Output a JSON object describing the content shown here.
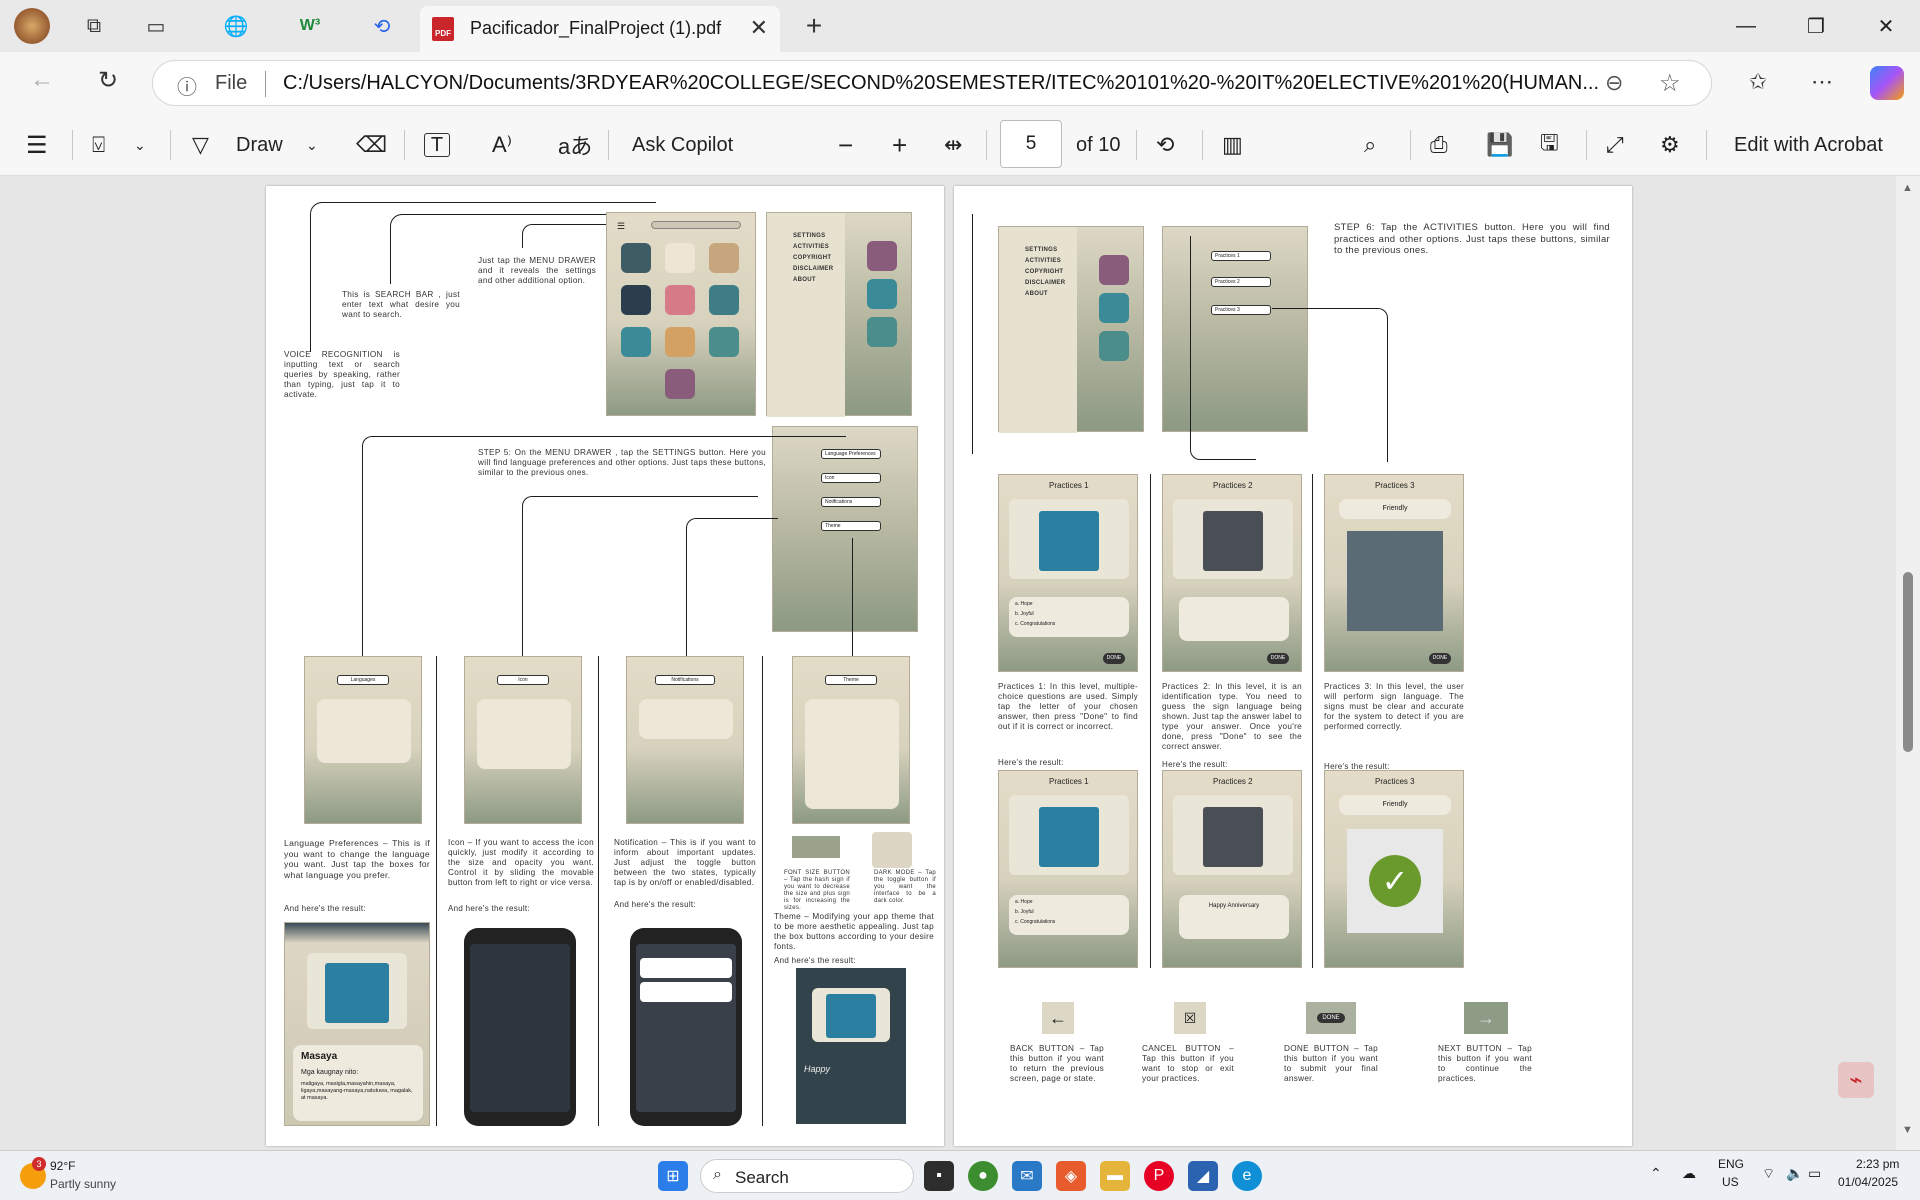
{
  "tabbar": {
    "active_tab_title": "Pacificador_FinalProject (1).pdf",
    "new_tab_symbol": "+",
    "close_tab_symbol": "✕",
    "pdf_badge": "PDF"
  },
  "address": {
    "info_label": "File",
    "url": "C:/Users/HALCYON/Documents/3RDYEAR%20COLLEGE/SECOND%20SEMESTER/ITEC%20101%20-%20IT%20ELECTIVE%201%20(HUMAN..."
  },
  "pdf_toolbar": {
    "draw_label": "Draw",
    "ask_copilot": "Ask Copilot",
    "page_current": "5",
    "page_total": "of 10",
    "edit_acrobat": "Edit with Acrobat"
  },
  "page_left": {
    "voice_note": "VOICE RECOGNITION is inputting text or search queries by speaking, rather than typing, just tap it to activate.",
    "search_note": "This is SEARCH BAR , just enter text what desire you want to search.",
    "menu_note": "Just tap the MENU DRAWER and it reveals the settings and other additional option.",
    "menu_items": [
      "SETTINGS",
      "ACTIVITIES",
      "COPYRIGHT",
      "DISCLAIMER",
      "ABOUT"
    ],
    "step5_note": "STEP 5: On the MENU DRAWER , tap the SETTINGS button. Here you will find language preferences and other options. Just taps these buttons, similar to the previous ones.",
    "settings_items": [
      "Language Preferences",
      "Icon",
      "Notifications",
      "Theme"
    ],
    "screens": [
      "Languages",
      "Icon",
      "Notifications",
      "Theme"
    ],
    "lang_note": "Language Preferences – This is if you want to change the language you want. Just tap the boxes for what language you prefer.",
    "icon_note": "Icon – If you want to access the icon quickly, just modify it according to the size and opacity you want. Control it by sliding the movable button from left to right or vice versa.",
    "notif_note": "Notification – This is if you want to inform about important updates. Just adjust the toggle button between the two states, typically tap is by on/off or enabled/disabled.",
    "font_note": "FONT SIZE BUTTON – Tap the hash sign if you want to decrease the size and plus sign is for increasing the sizes.",
    "dark_note": "DARK MODE – Tap the toggle button if you want the interface to be a dark color.",
    "theme_note": "Theme – Modifying your app theme that to be more aesthetic appealing. Just tap the box buttons according to your desire fonts.",
    "result_label": "And here's the result:",
    "result_label2": "And here's the result:",
    "masaya_word": "Masaya",
    "masaya_sub": "Mga kaugnay nito:",
    "masaya_related": "maligaya, masigla,masayahin,masaya, ligaya,masayang-masaya,natutuwa, magalak, at masaya.",
    "happy_word": "Happy"
  },
  "page_right": {
    "step6_note": "STEP 6: Tap the ACTIVITIES button. Here you will find practices and other options. Just taps these buttons, similar to the previous ones.",
    "menu_items": [
      "SETTINGS",
      "ACTIVITIES",
      "COPYRIGHT",
      "DISCLAIMER",
      "ABOUT"
    ],
    "practice_chips": [
      "Practices 1",
      "Practices 2",
      "Practices 3"
    ],
    "p1_title": "Practices 1",
    "p2_title": "Practices 2",
    "p3_title": "Practices 3",
    "p1_options": [
      "a. Hope",
      "b. Joyful",
      "c. Congratulations"
    ],
    "p3_word": "Friendly",
    "done_label": "DONE",
    "p1_note": "Practices 1: In this level, multiple-choice questions are used. Simply tap the letter of your chosen answer, then press \"Done\" to find out if it is correct or incorrect.",
    "p2_note": "Practices 2: In this level, it is an identification type. You need to guess the sign language being shown. Just tap the answer label to type your answer. Once you're done, press \"Done\" to see the correct answer.",
    "p3_note": "Practices 3: In this level, the user will perform sign language. The signs must be clear and accurate for the system to detect if you are performed correctly.",
    "result_label": "Here's the result:",
    "p2_answer": "Happy Anniversary",
    "back_note": "BACK BUTTON – Tap this button if you want to return the previous screen, page or state.",
    "cancel_note": "CANCEL BUTTON – Tap this button if you want to stop or exit your practices.",
    "done_note": "DONE BUTTON – Tap this button if you want to submit your final answer.",
    "next_note": "NEXT BUTTON – Tap this button if you want to continue the practices."
  },
  "taskbar": {
    "weather_temp": "92°F",
    "weather_desc": "Partly sunny",
    "weather_badge": "3",
    "search_label": "Search",
    "lang": "ENG",
    "region": "US",
    "time": "2:23 pm",
    "date": "01/04/2025"
  },
  "colors": {
    "accent": "#c9252b",
    "tabbar_bg": "#e9e9ea",
    "toolbar_bg": "#f7f7f7",
    "phone_top": "#e3dcc8",
    "phone_bottom": "#8d9a84"
  }
}
